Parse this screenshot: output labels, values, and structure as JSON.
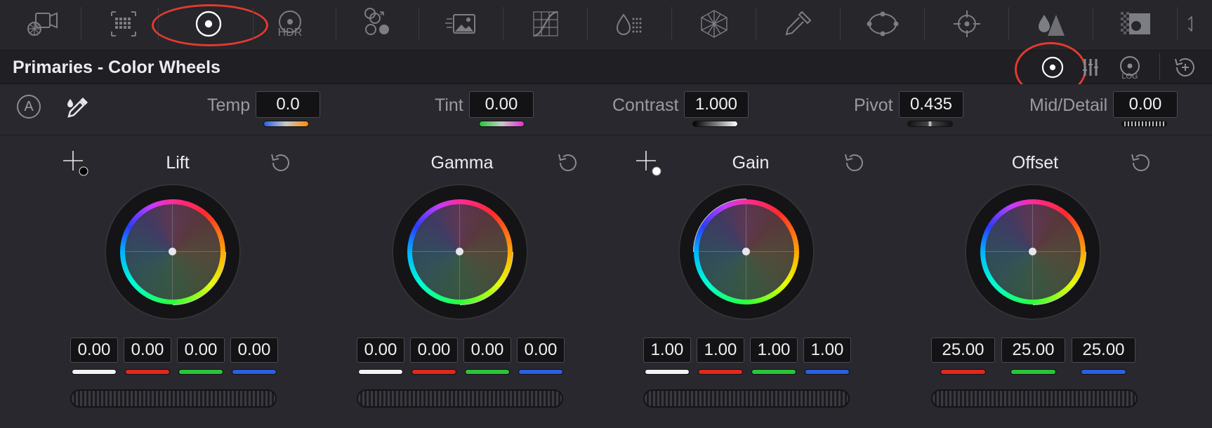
{
  "toolbar": {
    "icons": [
      "camera-raw-icon",
      "color-match-icon",
      "color-wheels-icon",
      "hdr-wheels-icon",
      "rgb-mixer-icon",
      "motion-effects-icon",
      "curves-icon",
      "color-warper-icon",
      "qualifier-icon",
      "window-icon",
      "tracker-icon",
      "magic-mask-icon",
      "blur-icon",
      "key-icon",
      "sizing-icon"
    ],
    "hdr_label": "HDR",
    "active": "color-wheels-icon"
  },
  "header": {
    "title": "Primaries - Color Wheels",
    "log_label": "LOG"
  },
  "adjustments": {
    "auto_label": "A",
    "temp": {
      "label": "Temp",
      "value": "0.0"
    },
    "tint": {
      "label": "Tint",
      "value": "0.00"
    },
    "contrast": {
      "label": "Contrast",
      "value": "1.000"
    },
    "pivot": {
      "label": "Pivot",
      "value": "0.435"
    },
    "middetail": {
      "label": "Mid/Detail",
      "value": "0.00"
    }
  },
  "wheels": {
    "lift": {
      "title": "Lift",
      "values": [
        "0.00",
        "0.00",
        "0.00",
        "0.00"
      ]
    },
    "gamma": {
      "title": "Gamma",
      "values": [
        "0.00",
        "0.00",
        "0.00",
        "0.00"
      ]
    },
    "gain": {
      "title": "Gain",
      "values": [
        "1.00",
        "1.00",
        "1.00",
        "1.00"
      ]
    },
    "offset": {
      "title": "Offset",
      "values": [
        "25.00",
        "25.00",
        "25.00"
      ]
    }
  },
  "colors": {
    "accent_annotation": "#e23a2f",
    "channel_y": "#f2f2f2",
    "channel_r": "#e0281e",
    "channel_g": "#29c43a",
    "channel_b": "#2c5fe0"
  }
}
